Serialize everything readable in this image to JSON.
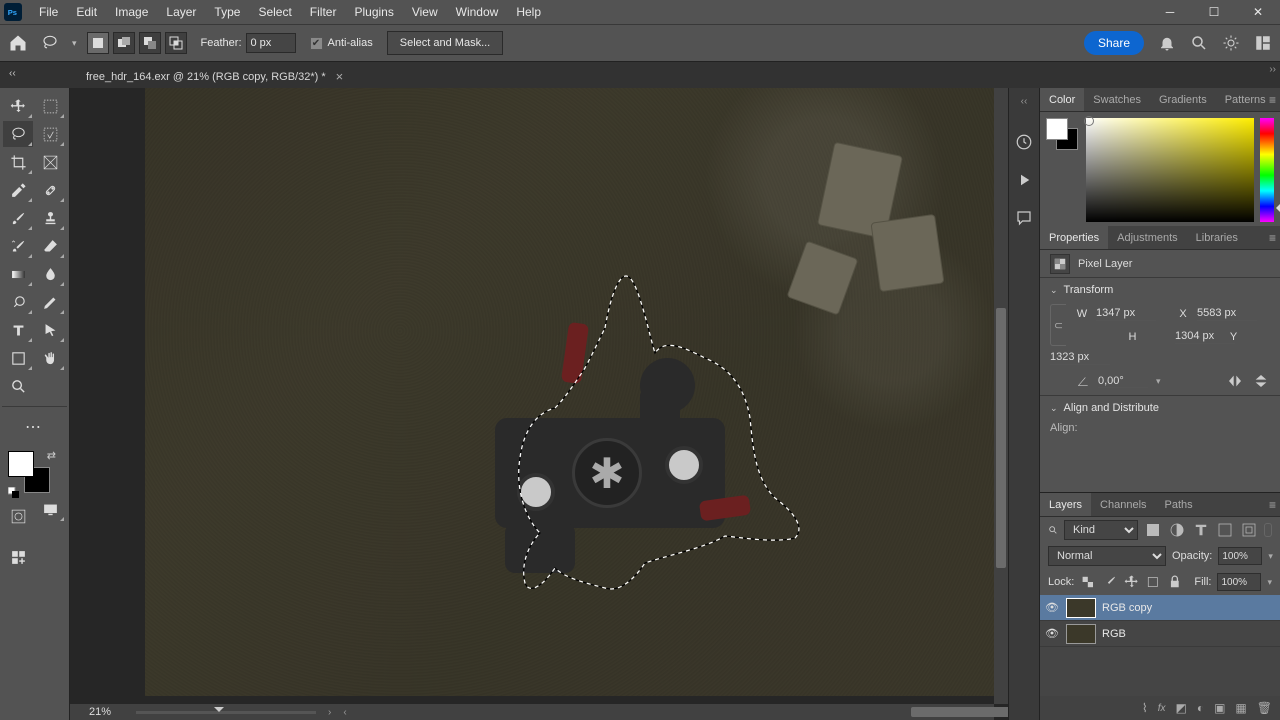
{
  "menu": {
    "items": [
      "File",
      "Edit",
      "Image",
      "Layer",
      "Type",
      "Select",
      "Filter",
      "Plugins",
      "View",
      "Window",
      "Help"
    ]
  },
  "options": {
    "feather_label": "Feather:",
    "feather_value": "0 px",
    "antialias": "Anti-alias",
    "select_mask": "Select and Mask...",
    "share": "Share"
  },
  "tab": {
    "title": "free_hdr_164.exr @ 21% (RGB copy, RGB/32*) *"
  },
  "status": {
    "zoom": "21%"
  },
  "color_tabs": [
    "Color",
    "Swatches",
    "Gradients",
    "Patterns"
  ],
  "prop_tabs": [
    "Properties",
    "Adjustments",
    "Libraries"
  ],
  "properties": {
    "layer_type": "Pixel Layer",
    "transform_label": "Transform",
    "W": "1347 px",
    "H": "1304 px",
    "X": "5583 px",
    "Y": "1323 px",
    "angle": "0,00°",
    "align_label": "Align and Distribute",
    "align_sub": "Align:"
  },
  "layer_tabs": [
    "Layers",
    "Channels",
    "Paths"
  ],
  "layers": {
    "kind": "Kind",
    "blend": "Normal",
    "opacity_label": "Opacity:",
    "opacity": "100%",
    "lock_label": "Lock:",
    "fill_label": "Fill:",
    "fill": "100%",
    "items": [
      {
        "name": "RGB copy"
      },
      {
        "name": "RGB"
      }
    ]
  }
}
